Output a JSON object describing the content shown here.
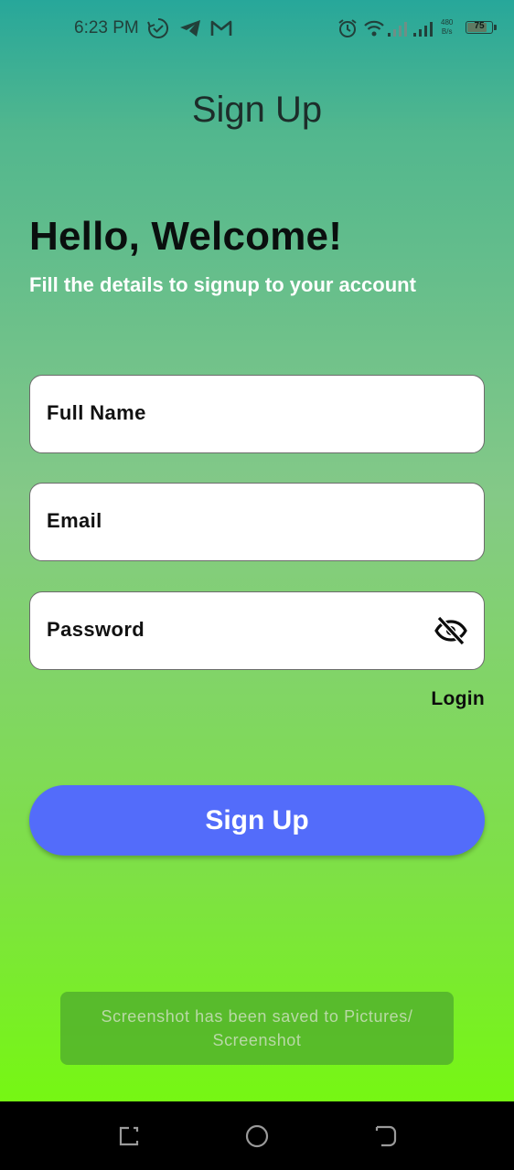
{
  "status_bar": {
    "time": "6:23 PM",
    "icons": [
      "sync-check-icon",
      "telegram-icon",
      "gmail-icon",
      "alarm-icon",
      "wifi-icon",
      "signal-icon",
      "signal-icon"
    ],
    "net_speed_value": "480",
    "net_speed_unit": "B/s",
    "battery": "75"
  },
  "header": {
    "title": "Sign Up"
  },
  "welcome": {
    "heading": "Hello, Welcome!",
    "subtitle": "Fill the details to signup to your account"
  },
  "form": {
    "full_name_placeholder": "Full Name",
    "email_placeholder": "Email",
    "password_placeholder": "Password",
    "password_toggle_icon": "eye-off-icon",
    "login_link": "Login",
    "submit_label": "Sign Up"
  },
  "toast": {
    "message": "Screenshot has been saved to  Pictures/ Screenshot"
  },
  "nav_bar": {
    "icons": [
      "recent-apps-icon",
      "home-icon",
      "back-icon"
    ]
  },
  "colors": {
    "gradient_top": "#27a79a",
    "gradient_bottom": "#76f713",
    "button": "#536cfa"
  }
}
